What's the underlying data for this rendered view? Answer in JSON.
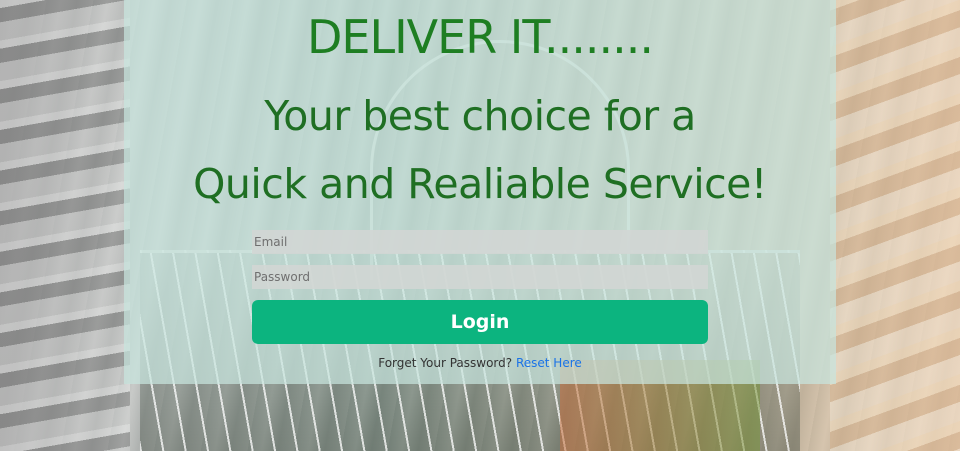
{
  "hero": {
    "title": "DELIVER IT........",
    "tagline_line1": "Your best choice for a",
    "tagline_line2": "Quick and Realiable Service!"
  },
  "login_form": {
    "email_placeholder": "Email",
    "password_placeholder": "Password",
    "login_label": "Login",
    "forgot_text": "Forget Your Password?",
    "reset_link_label": "Reset Here"
  },
  "colors": {
    "headline_green": "#1f6f23",
    "button_green": "#0cb47f",
    "link_blue": "#1a73e8"
  }
}
